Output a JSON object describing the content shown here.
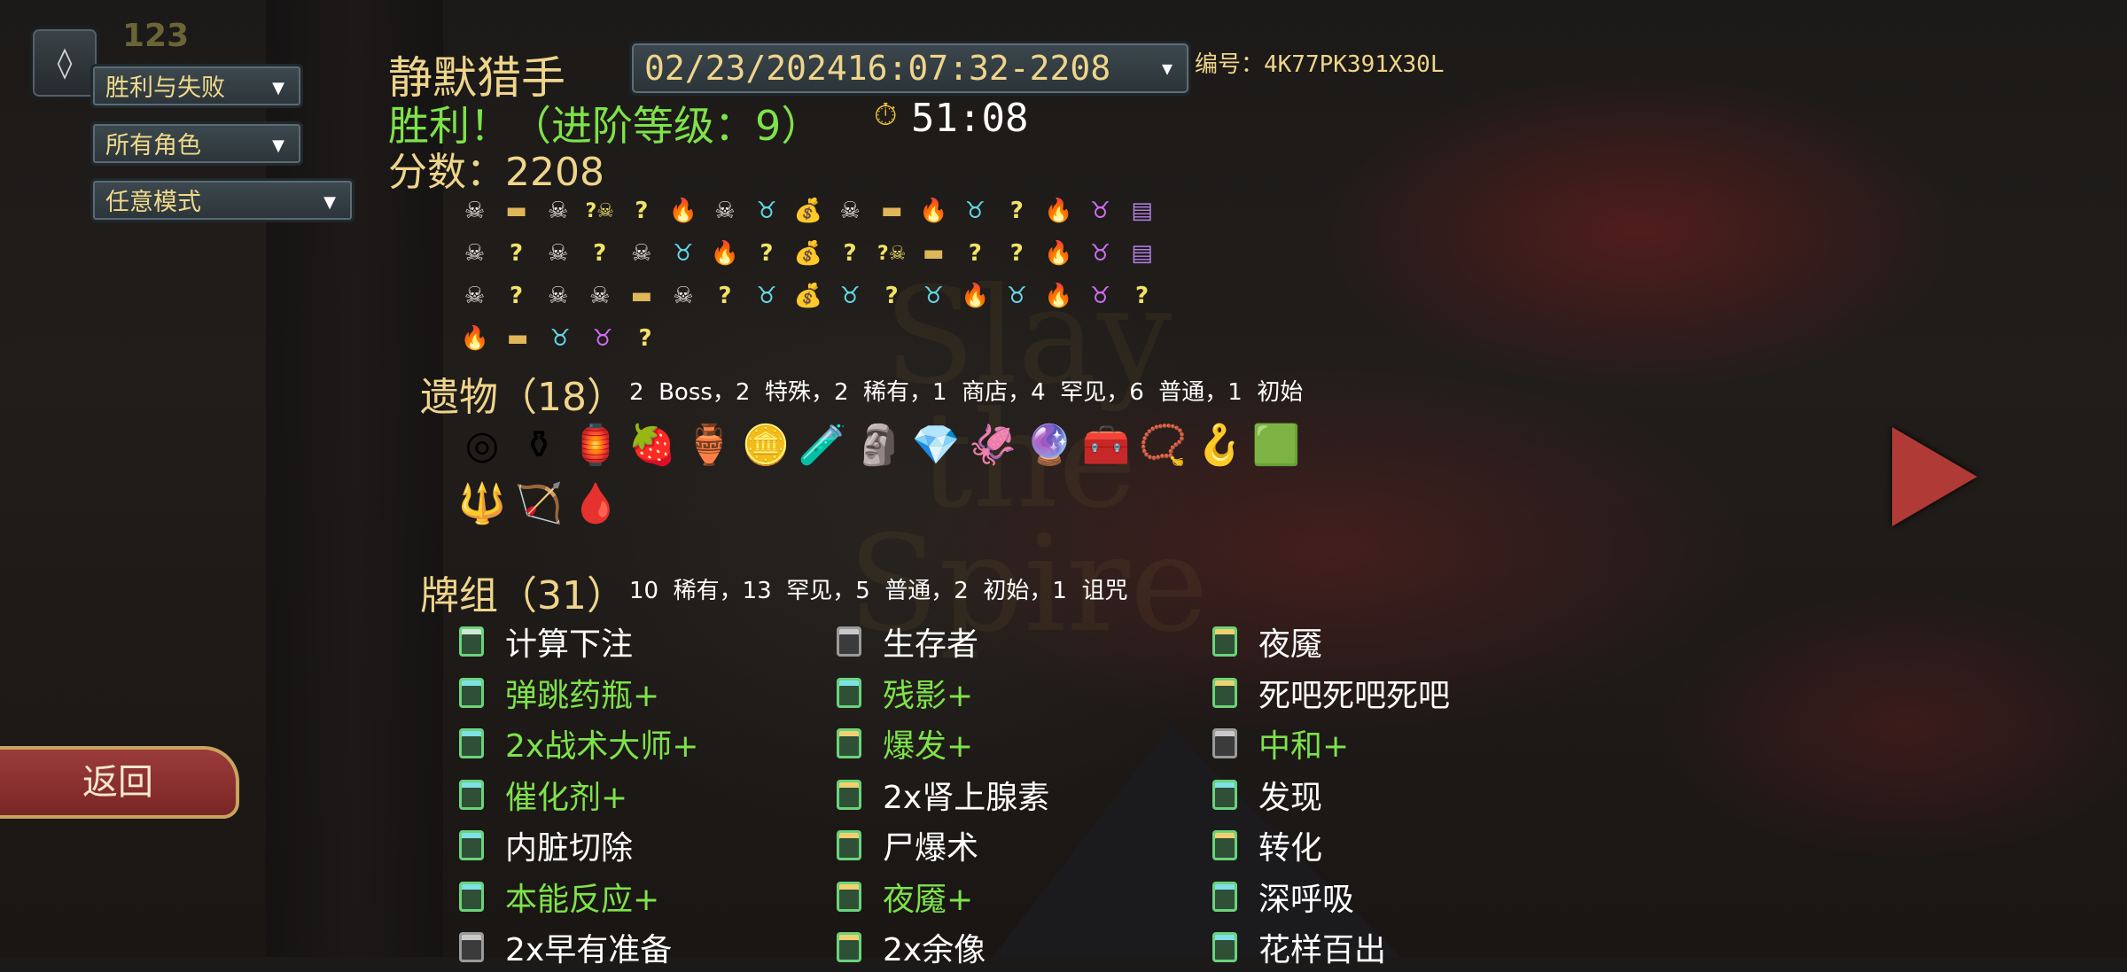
{
  "top_counter": "123",
  "filters": {
    "outcome": "胜利与失败",
    "character": "所有角色",
    "mode": "任意模式"
  },
  "back_label": "返回",
  "run": {
    "character_name": "静默猎手",
    "seed_selection": "02/23/202416:07:32-2208",
    "seed_label": "编号：4K77PK391X30L",
    "result": "胜利！（进阶等级：9）",
    "play_time": "51:08",
    "score": "分数：2208"
  },
  "path_rows": [
    [
      "monster",
      "treasure",
      "monster",
      "unknown-monster",
      "event",
      "rest",
      "monster",
      "elite",
      "shop",
      "monster",
      "treasure",
      "rest",
      "elite",
      "event",
      "rest",
      "boss",
      "bosschest"
    ],
    [
      "monster",
      "event",
      "monster",
      "event",
      "monster",
      "elite",
      "rest",
      "event",
      "shop",
      "event",
      "unknown-monster",
      "treasure",
      "event",
      "event",
      "rest",
      "boss",
      "bosschest"
    ],
    [
      "monster",
      "event",
      "monster",
      "monster",
      "treasure",
      "monster",
      "event",
      "elite",
      "shop",
      "elite",
      "event",
      "elite",
      "rest",
      "elite",
      "rest",
      "boss",
      "event"
    ],
    [
      "rest",
      "treasure",
      "elite",
      "boss",
      "event"
    ]
  ],
  "relics": {
    "title": "遗物（18）",
    "summary": "2  Boss，2  特殊，2  稀有，1  商店，4  罕见，6  普通，1  初始",
    "rows": [
      [
        "ring-relic-icon",
        "green-urn-relic-icon",
        "blue-lantern-relic-icon",
        "strawberry-relic-icon",
        "purple-pot-relic-icon",
        "gold-coin-relic-icon",
        "blue-potion-relic-icon",
        "idol-relic-icon",
        "crystal-relic-icon",
        "red-claw-relic-icon",
        "orb-relic-icon",
        "chest-relic-icon",
        "beads-relic-icon",
        "pipe-relic-icon",
        "green-bar-relic-icon"
      ],
      [
        "fork-relic-icon",
        "bow-relic-icon",
        "blood-vial-relic-icon"
      ]
    ]
  },
  "deck": {
    "title": "牌组（31）",
    "summary": "10  稀有，13  罕见，5  普通，2  初始，1  诅咒",
    "columns": [
      [
        {
          "name": "计算下注",
          "upgraded": false,
          "rarity": "common"
        },
        {
          "name": "弹跳药瓶+",
          "upgraded": true,
          "rarity": "uncommon"
        },
        {
          "name": "2x战术大师+",
          "upgraded": true,
          "rarity": "uncommon"
        },
        {
          "name": "催化剂+",
          "upgraded": true,
          "rarity": "uncommon"
        },
        {
          "name": "内脏切除",
          "upgraded": false,
          "rarity": "uncommon"
        },
        {
          "name": "本能反应+",
          "upgraded": true,
          "rarity": "uncommon"
        },
        {
          "name": "2x早有准备",
          "upgraded": false,
          "rarity": "basic"
        }
      ],
      [
        {
          "name": "生存者",
          "upgraded": false,
          "rarity": "basic"
        },
        {
          "name": "残影+",
          "upgraded": true,
          "rarity": "uncommon"
        },
        {
          "name": "爆发+",
          "upgraded": true,
          "rarity": "rare"
        },
        {
          "name": "2x肾上腺素",
          "upgraded": false,
          "rarity": "rare"
        },
        {
          "name": "尸爆术",
          "upgraded": false,
          "rarity": "rare"
        },
        {
          "name": "夜魇+",
          "upgraded": true,
          "rarity": "rare"
        },
        {
          "name": "2x余像",
          "upgraded": false,
          "rarity": "rare"
        }
      ],
      [
        {
          "name": "夜魇",
          "upgraded": false,
          "rarity": "rare"
        },
        {
          "name": "死吧死吧死吧",
          "upgraded": false,
          "rarity": "rare"
        },
        {
          "name": "中和+",
          "upgraded": true,
          "rarity": "basic"
        },
        {
          "name": "发现",
          "upgraded": false,
          "rarity": "uncommon"
        },
        {
          "name": "转化",
          "upgraded": false,
          "rarity": "rare"
        },
        {
          "name": "深呼吸",
          "upgraded": false,
          "rarity": "uncommon"
        },
        {
          "name": "花样百出",
          "upgraded": false,
          "rarity": "uncommon"
        }
      ]
    ]
  },
  "colors": {
    "gold_text": "#efd58b",
    "victory_green": "#7ee24a",
    "upgraded_green": "#7ee24a"
  }
}
